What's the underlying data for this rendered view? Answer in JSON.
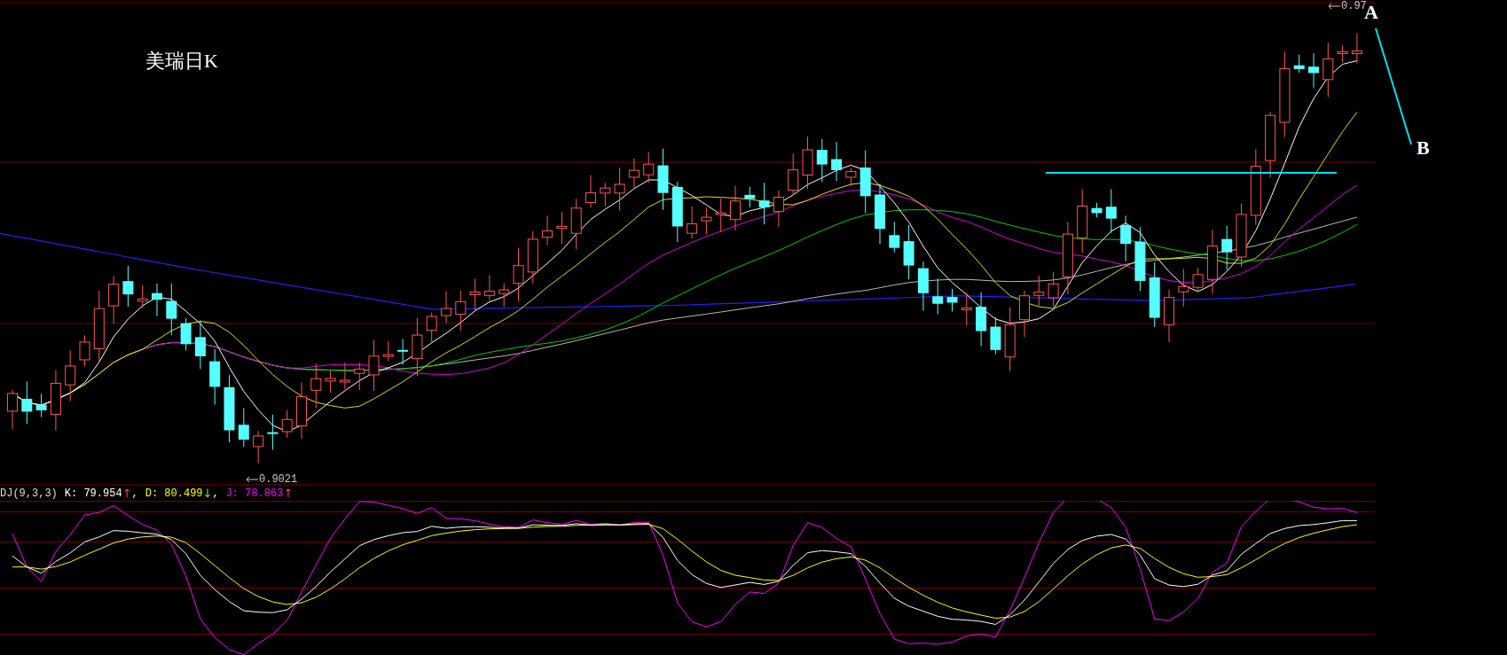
{
  "chart": {
    "title": "美瑞日K",
    "high_label": "0.97",
    "low_label": "0.9021",
    "point_labels": [
      {
        "text": "A",
        "kind": "start"
      },
      {
        "text": "B",
        "kind": "end"
      }
    ]
  },
  "indicator": {
    "name": "DJ(9,3,3)",
    "items": [
      {
        "text": "K: 79.954",
        "arrow": {
          "text": "↑",
          "kind": "rise"
        },
        "separator": ","
      },
      {
        "text": "D: 80.499",
        "arrow": {
          "text": "↓",
          "kind": "fall"
        },
        "separator": ","
      },
      {
        "text": "J: 78.863",
        "arrow": {
          "text": "↑",
          "kind": "rise"
        }
      }
    ]
  }
}
